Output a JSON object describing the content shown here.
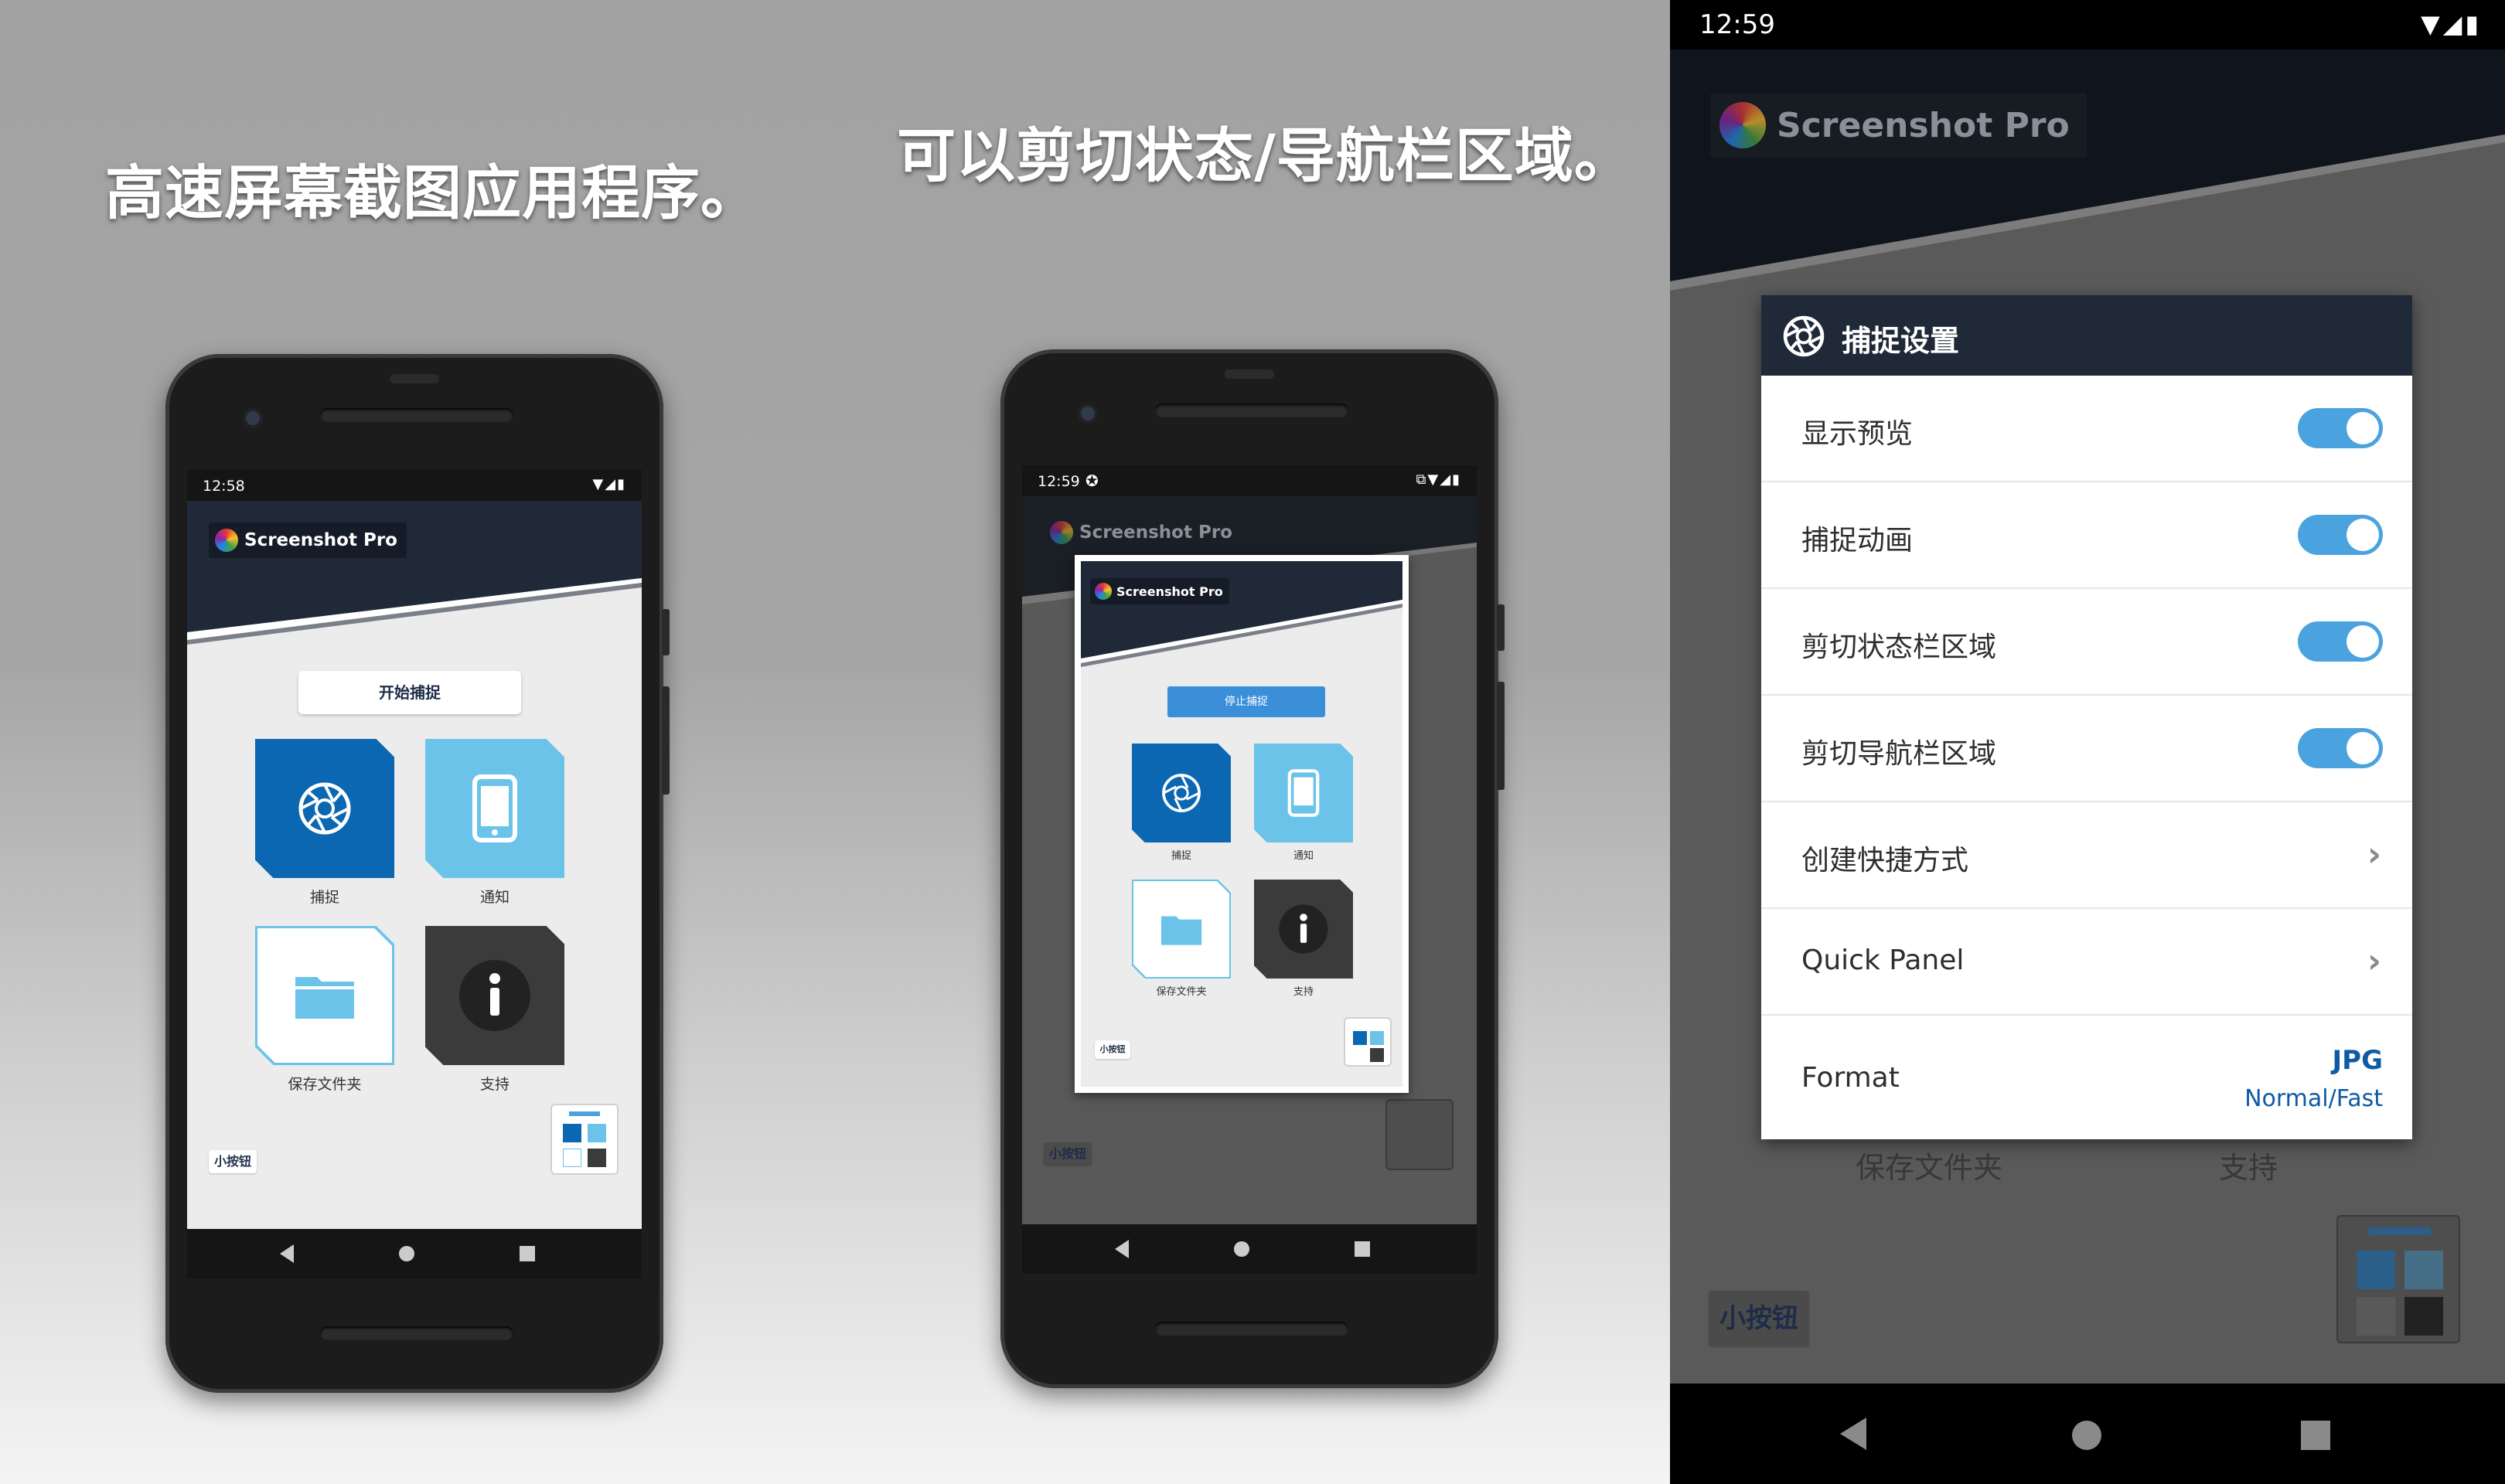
{
  "captions": {
    "left": "高速屏幕截图应用程序。",
    "middle": "可以剪切状态/导航栏区域。"
  },
  "app": {
    "name": "Screenshot Pro",
    "start_button": "开始捕捉",
    "stop_button": "停止捕捉",
    "tiles": [
      {
        "label": "捕捉",
        "icon": "shutter-icon",
        "color": "#0b67b2"
      },
      {
        "label": "通知",
        "icon": "phone-icon",
        "color": "#6cc3ea"
      },
      {
        "label": "保存文件夹",
        "icon": "folder-icon",
        "color": "#ffffff"
      },
      {
        "label": "支持",
        "icon": "info-icon",
        "color": "#3b3b3b"
      }
    ],
    "mini_button": "小按钮"
  },
  "phone1": {
    "time": "12:58"
  },
  "phone2": {
    "time": "12:59"
  },
  "settings": {
    "time": "12:59",
    "app_name": "Screenshot Pro",
    "bg_labels": [
      "保存文件夹",
      "支持"
    ],
    "mini_button": "小按钮",
    "dialog_title": "捕捉设置",
    "rows": [
      {
        "label": "显示预览",
        "type": "toggle",
        "on": true
      },
      {
        "label": "捕捉动画",
        "type": "toggle",
        "on": true
      },
      {
        "label": "剪切状态栏区域",
        "type": "toggle",
        "on": true
      },
      {
        "label": "剪切导航栏区域",
        "type": "toggle",
        "on": true
      },
      {
        "label": "创建快捷方式",
        "type": "link"
      },
      {
        "label": "Quick Panel",
        "type": "link"
      }
    ],
    "format": {
      "label": "Format",
      "value": "JPG",
      "sub": "Normal/Fast"
    }
  },
  "colors": {
    "accent_toggle": "#4aa3df",
    "header_dark": "#1f2937",
    "tile_blue": "#0b67b2",
    "tile_light_blue": "#6cc3ea",
    "tile_dark": "#3b3b3b"
  }
}
